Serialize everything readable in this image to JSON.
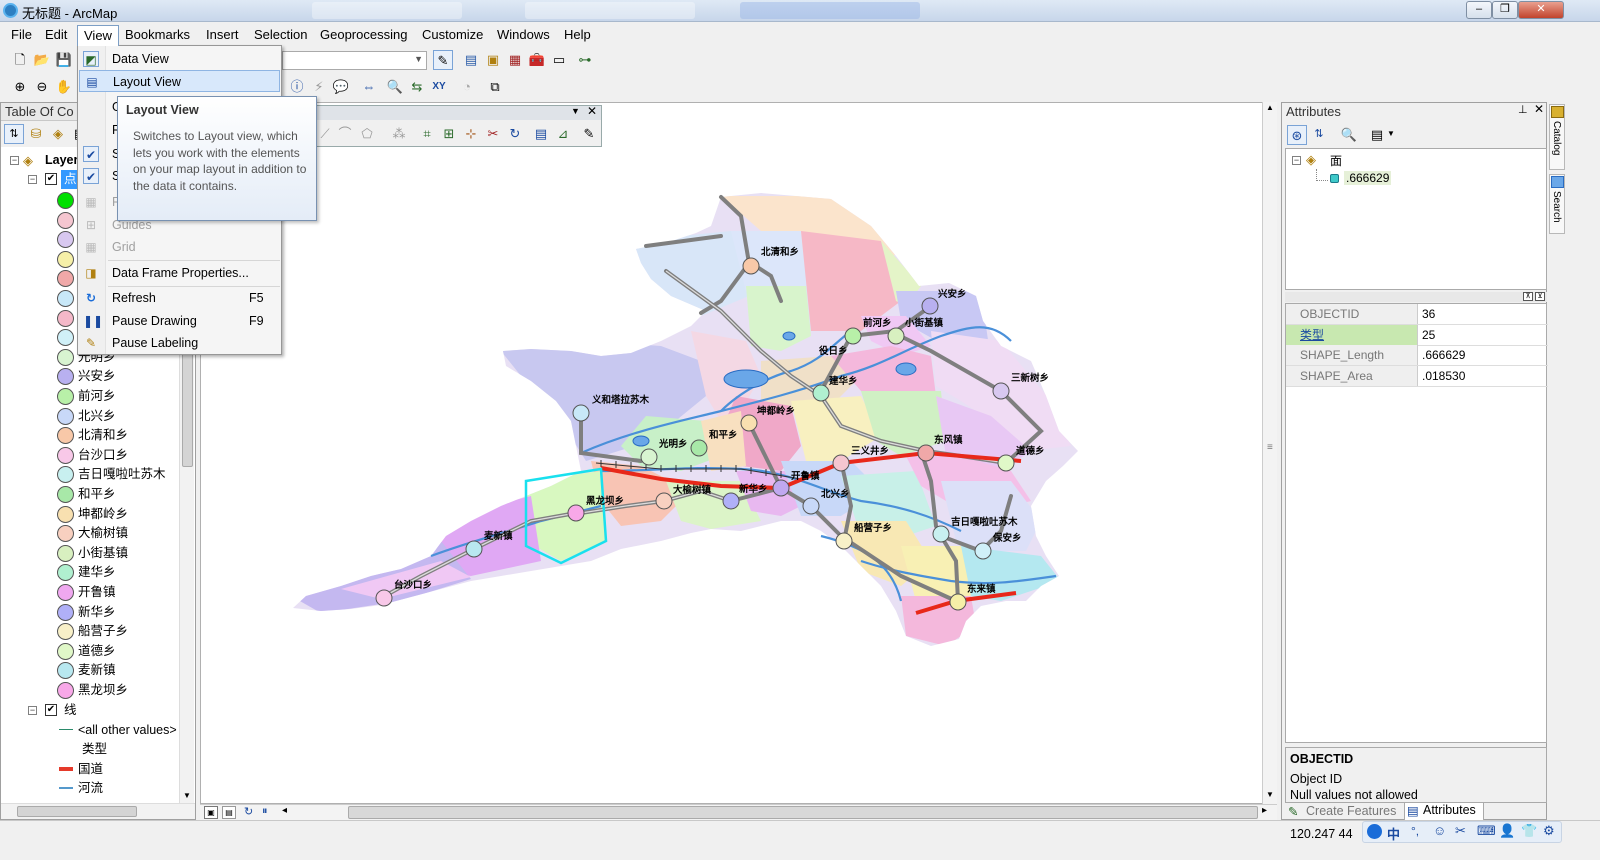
{
  "window": {
    "title": "无标题 - ArcMap"
  },
  "menubar": {
    "items": [
      "File",
      "Edit",
      "View",
      "Bookmarks",
      "Insert",
      "Selection",
      "Geoprocessing",
      "Customize",
      "Windows",
      "Help"
    ]
  },
  "view_menu": {
    "items": [
      {
        "label": "Data View",
        "shortcut": "",
        "icon": "data-view-icon",
        "state": "normal"
      },
      {
        "label": "Layout View",
        "shortcut": "",
        "icon": "layout-view-icon",
        "state": "hover"
      },
      {
        "label": "G",
        "shortcut": "",
        "icon": "",
        "state": "obscured"
      },
      {
        "label": "R",
        "shortcut": "",
        "icon": "",
        "state": "obscured"
      },
      {
        "label": "S",
        "shortcut": "",
        "icon": "check-icon",
        "state": "checked"
      },
      {
        "label": "S",
        "shortcut": "",
        "icon": "check-icon",
        "state": "checked"
      },
      {
        "label": "R",
        "shortcut": "",
        "icon": "rulers-icon",
        "state": "disabled"
      },
      {
        "label": "Guides",
        "shortcut": "",
        "icon": "guides-icon",
        "state": "disabled"
      },
      {
        "label": "Grid",
        "shortcut": "",
        "icon": "grid-icon",
        "state": "disabled"
      },
      {
        "label": "Data Frame Properties...",
        "shortcut": "",
        "icon": "data-frame-properties-icon",
        "state": "normal"
      },
      {
        "label": "Refresh",
        "shortcut": "F5",
        "icon": "refresh-icon",
        "state": "normal"
      },
      {
        "label": "Pause Drawing",
        "shortcut": "F9",
        "icon": "pause-icon",
        "state": "normal"
      },
      {
        "label": "Pause Labeling",
        "shortcut": "",
        "icon": "pause-labeling-icon",
        "state": "normal"
      }
    ]
  },
  "tooltip": {
    "title": "Layout View",
    "body": "Switches to Layout view, which lets you work with the elements on your map layout in addition to the data it contains."
  },
  "toc": {
    "header": "Table Of Co",
    "root_label": "Layer",
    "layer1_label": "点",
    "point_items": [
      {
        "label": "",
        "color": "#00e000"
      },
      {
        "label": "",
        "color": "#f5c6d0"
      },
      {
        "label": "",
        "color": "#d8c8f0"
      },
      {
        "label": "",
        "color": "#f6f0a8"
      },
      {
        "label": "",
        "color": "#f0a8a8"
      },
      {
        "label": "",
        "color": "#c8e8f8"
      },
      {
        "label": "",
        "color": "#f4b8c8"
      },
      {
        "label": "",
        "color": "#d0f0f8"
      },
      {
        "label": "光明乡",
        "color": "#d8f4d0"
      },
      {
        "label": "兴安乡",
        "color": "#b8b0f0"
      },
      {
        "label": "前河乡",
        "color": "#b8f0a8"
      },
      {
        "label": "北兴乡",
        "color": "#c8d8f8"
      },
      {
        "label": "北清和乡",
        "color": "#f8c8a8"
      },
      {
        "label": "台沙口乡",
        "color": "#f8c8e8"
      },
      {
        "label": "吉日嘎啦吐苏木",
        "color": "#c8f0f0"
      },
      {
        "label": "和平乡",
        "color": "#a8e8a8"
      },
      {
        "label": "坤都岭乡",
        "color": "#f8e0b0"
      },
      {
        "label": "大榆树镇",
        "color": "#f8d0c0"
      },
      {
        "label": "小街基镇",
        "color": "#d8f0c0"
      },
      {
        "label": "建华乡",
        "color": "#b0f0d0"
      },
      {
        "label": "开鲁镇",
        "color": "#f0a8f0"
      },
      {
        "label": "新华乡",
        "color": "#b0b0f8"
      },
      {
        "label": "船营子乡",
        "color": "#f8f0c8"
      },
      {
        "label": "道德乡",
        "color": "#e0f8c8"
      },
      {
        "label": "麦新镇",
        "color": "#b8e8f0"
      },
      {
        "label": "黑龙坝乡",
        "color": "#f8a8e8"
      }
    ],
    "layer2_label": "线",
    "line_items": [
      {
        "label": "<all other values>",
        "color": "#2a8a6a"
      },
      {
        "label": "类型",
        "color": ""
      },
      {
        "label": "国道",
        "color": "#e53a2a"
      },
      {
        "label": "河流",
        "color": "#5599cc"
      }
    ]
  },
  "attributes": {
    "header": "Attributes",
    "tree_root": "面",
    "tree_child": ".666629",
    "fields": [
      {
        "name": "OBJECTID",
        "value": "36"
      },
      {
        "name": "类型",
        "value": "25"
      },
      {
        "name": "SHAPE_Length",
        "value": ".666629"
      },
      {
        "name": "SHAPE_Area",
        "value": ".018530"
      }
    ],
    "desc_title": "OBJECTID",
    "desc_line1": "Object ID",
    "desc_line2": "Null values not allowed",
    "tab_create": "Create Features",
    "tab_attributes": "Attributes"
  },
  "rightstrip": {
    "catalog": "Catalog",
    "search": "Search"
  },
  "status": {
    "coords": "120.247  44"
  },
  "map": {
    "labels": [
      {
        "text": "北清和乡"
      },
      {
        "text": "兴安乡"
      },
      {
        "text": "前河乡"
      },
      {
        "text": "小街基镇"
      },
      {
        "text": "役日乡"
      },
      {
        "text": "建华乡"
      },
      {
        "text": "三新树乡"
      },
      {
        "text": "义和塔拉苏木"
      },
      {
        "text": "坤都岭乡"
      },
      {
        "text": "和平乡"
      },
      {
        "text": "光明乡"
      },
      {
        "text": "东风镇"
      },
      {
        "text": "三义井乡"
      },
      {
        "text": "道德乡"
      },
      {
        "text": "开鲁镇"
      },
      {
        "text": "大榆树镇"
      },
      {
        "text": "新华乡"
      },
      {
        "text": "北兴乡"
      },
      {
        "text": "黑龙坝乡"
      },
      {
        "text": "麦新镇"
      },
      {
        "text": "台沙口乡"
      },
      {
        "text": "船营子乡"
      },
      {
        "text": "吉日嘎啦吐苏木"
      },
      {
        "text": "保安乡"
      },
      {
        "text": "东来镇"
      }
    ]
  }
}
